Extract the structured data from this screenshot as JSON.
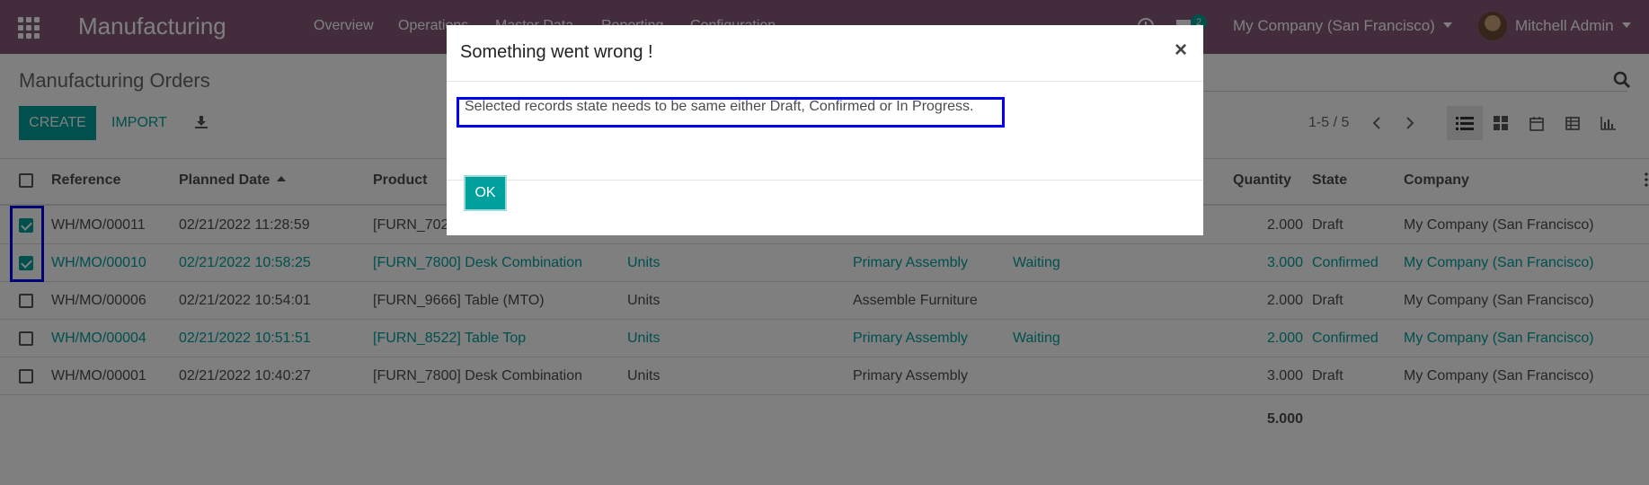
{
  "navbar": {
    "app_name": "Manufacturing",
    "menu": [
      "Overview",
      "Operations",
      "Master Data",
      "Reporting",
      "Configuration"
    ],
    "message_count": "2",
    "company": "My Company (San Francisco)",
    "user": "Mitchell Admin"
  },
  "control_panel": {
    "breadcrumb": "Manufacturing Orders",
    "create_label": "CREATE",
    "import_label": "IMPORT",
    "pager": "1-5 / 5"
  },
  "list": {
    "columns": {
      "reference": "Reference",
      "planned_date": "Planned Date",
      "product": "Product",
      "quantity": "Quantity",
      "state": "State",
      "company": "Company"
    },
    "rows": [
      {
        "checked": true,
        "reference": "WH/MO/00011",
        "date": "02/21/2022 11:28:59",
        "product": "[FURN_702",
        "uom": "",
        "route": "",
        "status": "",
        "quantity": "2.000",
        "state": "Draft",
        "company": "My Company (San Francisco)"
      },
      {
        "checked": true,
        "reference": "WH/MO/00010",
        "date": "02/21/2022 10:58:25",
        "product": "[FURN_7800] Desk Combination",
        "uom": "Units",
        "route": "Primary Assembly",
        "status": "Waiting",
        "quantity": "3.000",
        "state": "Confirmed",
        "company": "My Company (San Francisco)"
      },
      {
        "checked": false,
        "reference": "WH/MO/00006",
        "date": "02/21/2022 10:54:01",
        "product": "[FURN_9666] Table (MTO)",
        "uom": "Units",
        "route": "Assemble Furniture",
        "status": "",
        "quantity": "2.000",
        "state": "Draft",
        "company": "My Company (San Francisco)"
      },
      {
        "checked": false,
        "reference": "WH/MO/00004",
        "date": "02/21/2022 10:51:51",
        "product": "[FURN_8522] Table Top",
        "uom": "Units",
        "route": "Primary Assembly",
        "status": "Waiting",
        "quantity": "2.000",
        "state": "Confirmed",
        "company": "My Company (San Francisco)"
      },
      {
        "checked": false,
        "reference": "WH/MO/00001",
        "date": "02/21/2022 10:40:27",
        "product": "[FURN_7800] Desk Combination",
        "uom": "Units",
        "route": "Primary Assembly",
        "status": "",
        "quantity": "3.000",
        "state": "Draft",
        "company": "My Company (San Francisco)"
      }
    ],
    "total_quantity": "5.000"
  },
  "dialog": {
    "title": "Something went wrong !",
    "close_symbol": "×",
    "message": "Selected records state needs to be same either Draft, Confirmed or In Progress.",
    "ok_label": "OK"
  },
  "colors": {
    "navbar": "#875a7b",
    "accent": "#00a09d",
    "highlight": "#0000ee"
  }
}
